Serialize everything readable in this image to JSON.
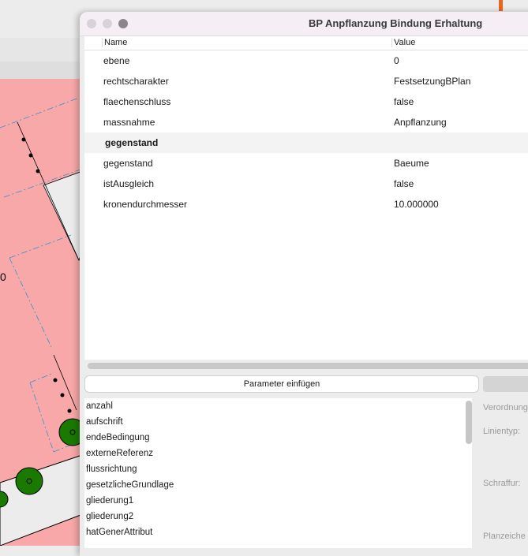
{
  "window": {
    "title": "BP Anpflanzung Bindung Erhaltung"
  },
  "map": {
    "label_fragment": "0"
  },
  "table": {
    "headers": {
      "name": "Name",
      "value": "Value"
    },
    "rows": [
      {
        "name": "ebene",
        "value": "0"
      },
      {
        "name": "rechtscharakter",
        "value": "FestsetzungBPlan"
      },
      {
        "name": "flaechenschluss",
        "value": "false"
      },
      {
        "name": "massnahme",
        "value": "Anpflanzung"
      },
      {
        "name": "gegenstand",
        "value": ""
      },
      {
        "name": "gegenstand",
        "value": "Baeume"
      },
      {
        "name": "istAusgleich",
        "value": "false"
      },
      {
        "name": "kronendurchmesser",
        "value": "10.000000"
      }
    ]
  },
  "insert_button": "Parameter einfügen",
  "params": [
    "anzahl",
    "aufschrift",
    "endeBedingung",
    "externeReferenz",
    "flussrichtung",
    "gesetzlicheGrundlage",
    "gliederung1",
    "gliederung2",
    "hatGenerAttribut"
  ],
  "right_panel": {
    "verordnung": "Verordnung",
    "linientyp": "Linientyp:",
    "schraffur": "Schraffur:",
    "planzeichen": "Planzeiche"
  }
}
